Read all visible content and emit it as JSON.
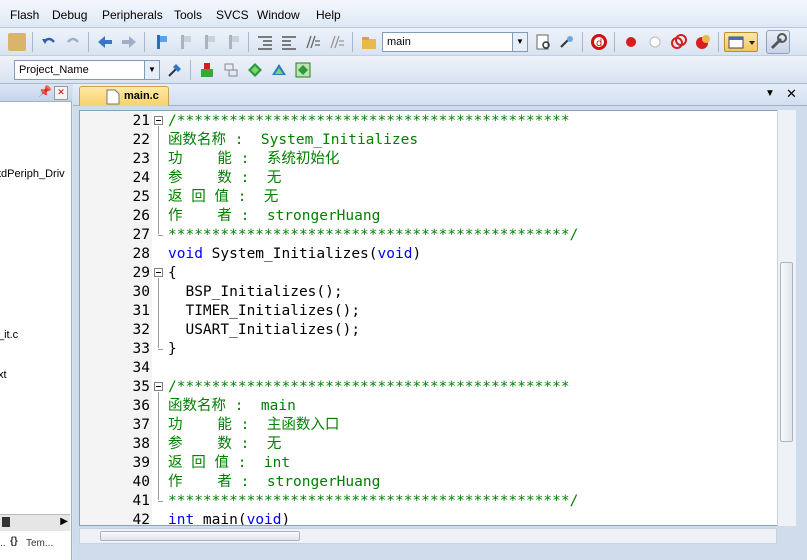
{
  "menu": [
    "Flash",
    "Debug",
    "Peripherals",
    "Tools",
    "SVCS",
    "Window",
    "Help"
  ],
  "toolbar": {
    "target_combo": "main"
  },
  "toolbar2": {
    "project_combo": "Project_Name"
  },
  "left_panel": {
    "items": [
      "tdPeriph_Driv",
      "_it.c",
      "xt"
    ],
    "bottom_tab": "Tem..."
  },
  "editor": {
    "tab_label": "main.c",
    "lines": [
      {
        "num": "21",
        "fold": "open",
        "parts": [
          {
            "c": "cm",
            "t": "/*********************************************"
          }
        ]
      },
      {
        "num": "22",
        "parts": [
          {
            "c": "cm",
            "t": "函数名称 :  System_Initializes"
          }
        ]
      },
      {
        "num": "23",
        "parts": [
          {
            "c": "cm",
            "t": "功    能 :  系统初始化"
          }
        ]
      },
      {
        "num": "24",
        "parts": [
          {
            "c": "cm",
            "t": "参    数 :  无"
          }
        ]
      },
      {
        "num": "25",
        "parts": [
          {
            "c": "cm",
            "t": "返 回 值 :  无"
          }
        ]
      },
      {
        "num": "26",
        "parts": [
          {
            "c": "cm",
            "t": "作    者 :  strongerHuang"
          }
        ]
      },
      {
        "num": "27",
        "fold": "end",
        "parts": [
          {
            "c": "cm",
            "t": "**********************************************/"
          }
        ]
      },
      {
        "num": "28",
        "parts": [
          {
            "c": "kw",
            "t": "void"
          },
          {
            "c": "tx",
            "t": " System_Initializes("
          },
          {
            "c": "kw",
            "t": "void"
          },
          {
            "c": "tx",
            "t": ")"
          }
        ]
      },
      {
        "num": "29",
        "fold": "open",
        "parts": [
          {
            "c": "tx",
            "t": "{"
          }
        ]
      },
      {
        "num": "30",
        "parts": [
          {
            "c": "tx",
            "t": "  BSP_Initializes();"
          }
        ]
      },
      {
        "num": "31",
        "parts": [
          {
            "c": "tx",
            "t": "  TIMER_Initializes();"
          }
        ]
      },
      {
        "num": "32",
        "parts": [
          {
            "c": "tx",
            "t": "  USART_Initializes();"
          }
        ]
      },
      {
        "num": "33",
        "fold": "end",
        "parts": [
          {
            "c": "tx",
            "t": "}"
          }
        ]
      },
      {
        "num": "34",
        "parts": []
      },
      {
        "num": "35",
        "fold": "open",
        "parts": [
          {
            "c": "cm",
            "t": "/*********************************************"
          }
        ]
      },
      {
        "num": "36",
        "parts": [
          {
            "c": "cm",
            "t": "函数名称 :  main"
          }
        ]
      },
      {
        "num": "37",
        "parts": [
          {
            "c": "cm",
            "t": "功    能 :  主函数入口"
          }
        ]
      },
      {
        "num": "38",
        "parts": [
          {
            "c": "cm",
            "t": "参    数 :  无"
          }
        ]
      },
      {
        "num": "39",
        "parts": [
          {
            "c": "cm",
            "t": "返 回 值 :  int"
          }
        ]
      },
      {
        "num": "40",
        "parts": [
          {
            "c": "cm",
            "t": "作    者 :  strongerHuang"
          }
        ]
      },
      {
        "num": "41",
        "fold": "end",
        "parts": [
          {
            "c": "cm",
            "t": "**********************************************/"
          }
        ]
      },
      {
        "num": "42",
        "parts": [
          {
            "c": "kw",
            "t": "int"
          },
          {
            "c": "tx",
            "t": " main("
          },
          {
            "c": "kw",
            "t": "void"
          },
          {
            "c": "tx",
            "t": ")"
          }
        ]
      }
    ]
  },
  "colors": {
    "comment": "#008000",
    "keyword": "#0000ff",
    "text": "#000000",
    "tab": "#f7d26a"
  },
  "icons": [
    "copy-icon",
    "undo-icon",
    "redo-icon",
    "back-icon",
    "forward-icon",
    "bookmark-icon",
    "indent-icon",
    "outdent-icon",
    "comment-icon",
    "find-icon",
    "debug-start-icon",
    "breakpoint-icon",
    "stop-icon",
    "settings-icon",
    "wrench-icon",
    "load-icon",
    "build-icon",
    "rebuild-icon",
    "batch-icon",
    "translate-icon"
  ]
}
